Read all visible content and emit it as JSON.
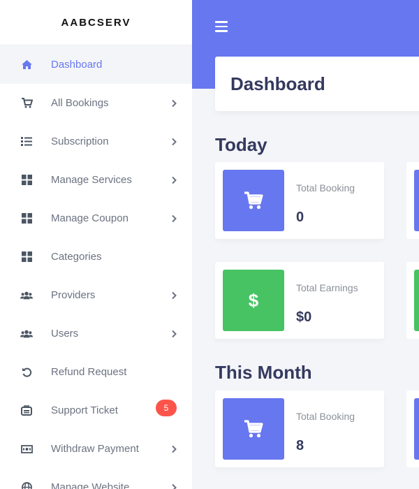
{
  "brand": "AABCSERV",
  "sidebar": {
    "items": [
      {
        "label": "Dashboard",
        "icon": "home-icon",
        "active": true,
        "chevron": false
      },
      {
        "label": "All Bookings",
        "icon": "cart-icon",
        "chevron": true
      },
      {
        "label": "Subscription",
        "icon": "list-icon",
        "chevron": true
      },
      {
        "label": "Manage Services",
        "icon": "grid-icon",
        "chevron": true
      },
      {
        "label": "Manage Coupon",
        "icon": "grid-icon",
        "chevron": true
      },
      {
        "label": "Categories",
        "icon": "grid-icon",
        "chevron": false
      },
      {
        "label": "Providers",
        "icon": "users-icon",
        "chevron": true
      },
      {
        "label": "Users",
        "icon": "users-icon",
        "chevron": true
      },
      {
        "label": "Refund Request",
        "icon": "undo-icon",
        "chevron": false
      },
      {
        "label": "Support Ticket",
        "icon": "ticket-icon",
        "chevron": false,
        "badge": "5"
      },
      {
        "label": "Withdraw Payment",
        "icon": "money-icon",
        "chevron": true
      },
      {
        "label": "Manage Website",
        "icon": "globe-icon",
        "chevron": true
      }
    ]
  },
  "header": {
    "menu_icon": "hamburger-icon"
  },
  "page_title": "Dashboard",
  "today": {
    "title": "Today",
    "cards": [
      {
        "label": "Total Booking",
        "value": "0",
        "icon": "cart-icon",
        "color": "#6777ef"
      },
      {
        "label": "Total Earnings",
        "value": "$0",
        "icon": "dollar-icon",
        "color": "#47c363"
      }
    ]
  },
  "month": {
    "title": "This Month",
    "cards": [
      {
        "label": "Total Booking",
        "value": "8",
        "icon": "cart-icon",
        "color": "#6777ef"
      }
    ]
  },
  "colors": {
    "primary": "#6777ef",
    "success": "#47c363",
    "danger": "#fc544b"
  }
}
